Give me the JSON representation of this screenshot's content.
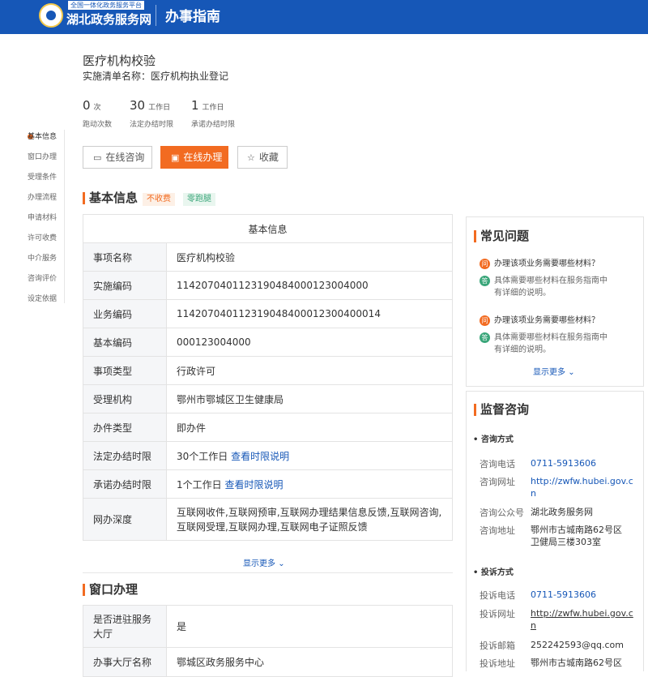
{
  "header": {
    "platform_small": "全国一体化政务服务平台",
    "platform_name": "湖北政务服务网",
    "section": "办事指南"
  },
  "item": {
    "title": "医疗机构校验",
    "list_name": "实施清单名称：医疗机构执业登记"
  },
  "stats": [
    {
      "value": "0",
      "unit": "次",
      "caption": "跑动次数"
    },
    {
      "value": "30",
      "unit": "工作日",
      "caption": "法定办结时限"
    },
    {
      "value": "1",
      "unit": "工作日",
      "caption": "承诺办结时限"
    }
  ],
  "actions": {
    "consult": "在线咨询",
    "online": "在线办理",
    "favorite": "收藏"
  },
  "sidenav": [
    "基本信息",
    "窗口办理",
    "受理条件",
    "办理流程",
    "申请材料",
    "许可收费",
    "中介服务",
    "咨询评价",
    "设定依据"
  ],
  "basic": {
    "section_title": "基本信息",
    "tag_fee": "不收费",
    "tag_run": "零跑腿",
    "table_title": "基本信息",
    "rows": [
      {
        "label": "事项名称",
        "value": "医疗机构校验"
      },
      {
        "label": "实施编码",
        "value": "11420704011231904840001230040​00"
      },
      {
        "label": "业务编码",
        "value": "114207040112319048400012300400014"
      },
      {
        "label": "基本编码",
        "value": "000123004000"
      },
      {
        "label": "事项类型",
        "value": "行政许可"
      },
      {
        "label": "受理机构",
        "value": "鄂州市鄂城区卫生健康局"
      },
      {
        "label": "办件类型",
        "value": "即办件"
      },
      {
        "label": "法定办结时限",
        "value": "30个工作日",
        "link": "查看时限说明"
      },
      {
        "label": "承诺办结时限",
        "value": "1个工作日",
        "link": "查看时限说明"
      },
      {
        "label": "网办深度",
        "value": "互联网收件,互联网预审,互联网办理结果信息反馈,互联网咨询,互联网受理,互联网办理,互联网电子证照反馈"
      }
    ],
    "show_more": "显示更多"
  },
  "window": {
    "section_title": "窗口办理",
    "rows": [
      {
        "label": "是否进驻服务大厅",
        "value": "是"
      },
      {
        "label": "办事大厅名称",
        "value": "鄂城区政务服务中心"
      }
    ]
  },
  "faq": {
    "title": "常见问题",
    "q_icon": "问",
    "a_icon": "答",
    "items": [
      {
        "q": "办理该项业务需要哪些材料？",
        "a1": "具体需要哪些材料在服务指南中",
        "a2": "有详细的说明。"
      },
      {
        "q": "办理该项业务需要哪些材料？",
        "a1": "具体需要哪些材料在服务指南中",
        "a2": "有详细的说明。"
      }
    ],
    "show_more": "显示更多"
  },
  "supervise": {
    "title": "监督咨询",
    "consult_title": "咨询方式",
    "complain_title": "投诉方式",
    "consult": {
      "phone_label": "咨询电话",
      "phone": "0711-5913606",
      "site_label": "咨询网址",
      "site1": "http://zwfw.hubei.gov.c",
      "site2": "n",
      "wechat_label": "咨询公众号",
      "wechat": "湖北政务服务网",
      "addr_label": "咨询地址",
      "addr1": "鄂州市古城南路62号区",
      "addr2": "卫健局三楼303室"
    },
    "complain": {
      "phone_label": "投诉电话",
      "phone": "0711-5913606",
      "site_label": "投诉网址",
      "site1": "http://zwfw.hubei.gov.c",
      "site2": "n",
      "mail_label": "投诉邮箱",
      "mail": "252242593@qq.com",
      "addr_label": "投诉地址",
      "addr1": "鄂州市古城南路62号区"
    }
  },
  "colors": {
    "brand": "#1657b7",
    "accent": "#f26b21",
    "green": "#3aa67a"
  }
}
